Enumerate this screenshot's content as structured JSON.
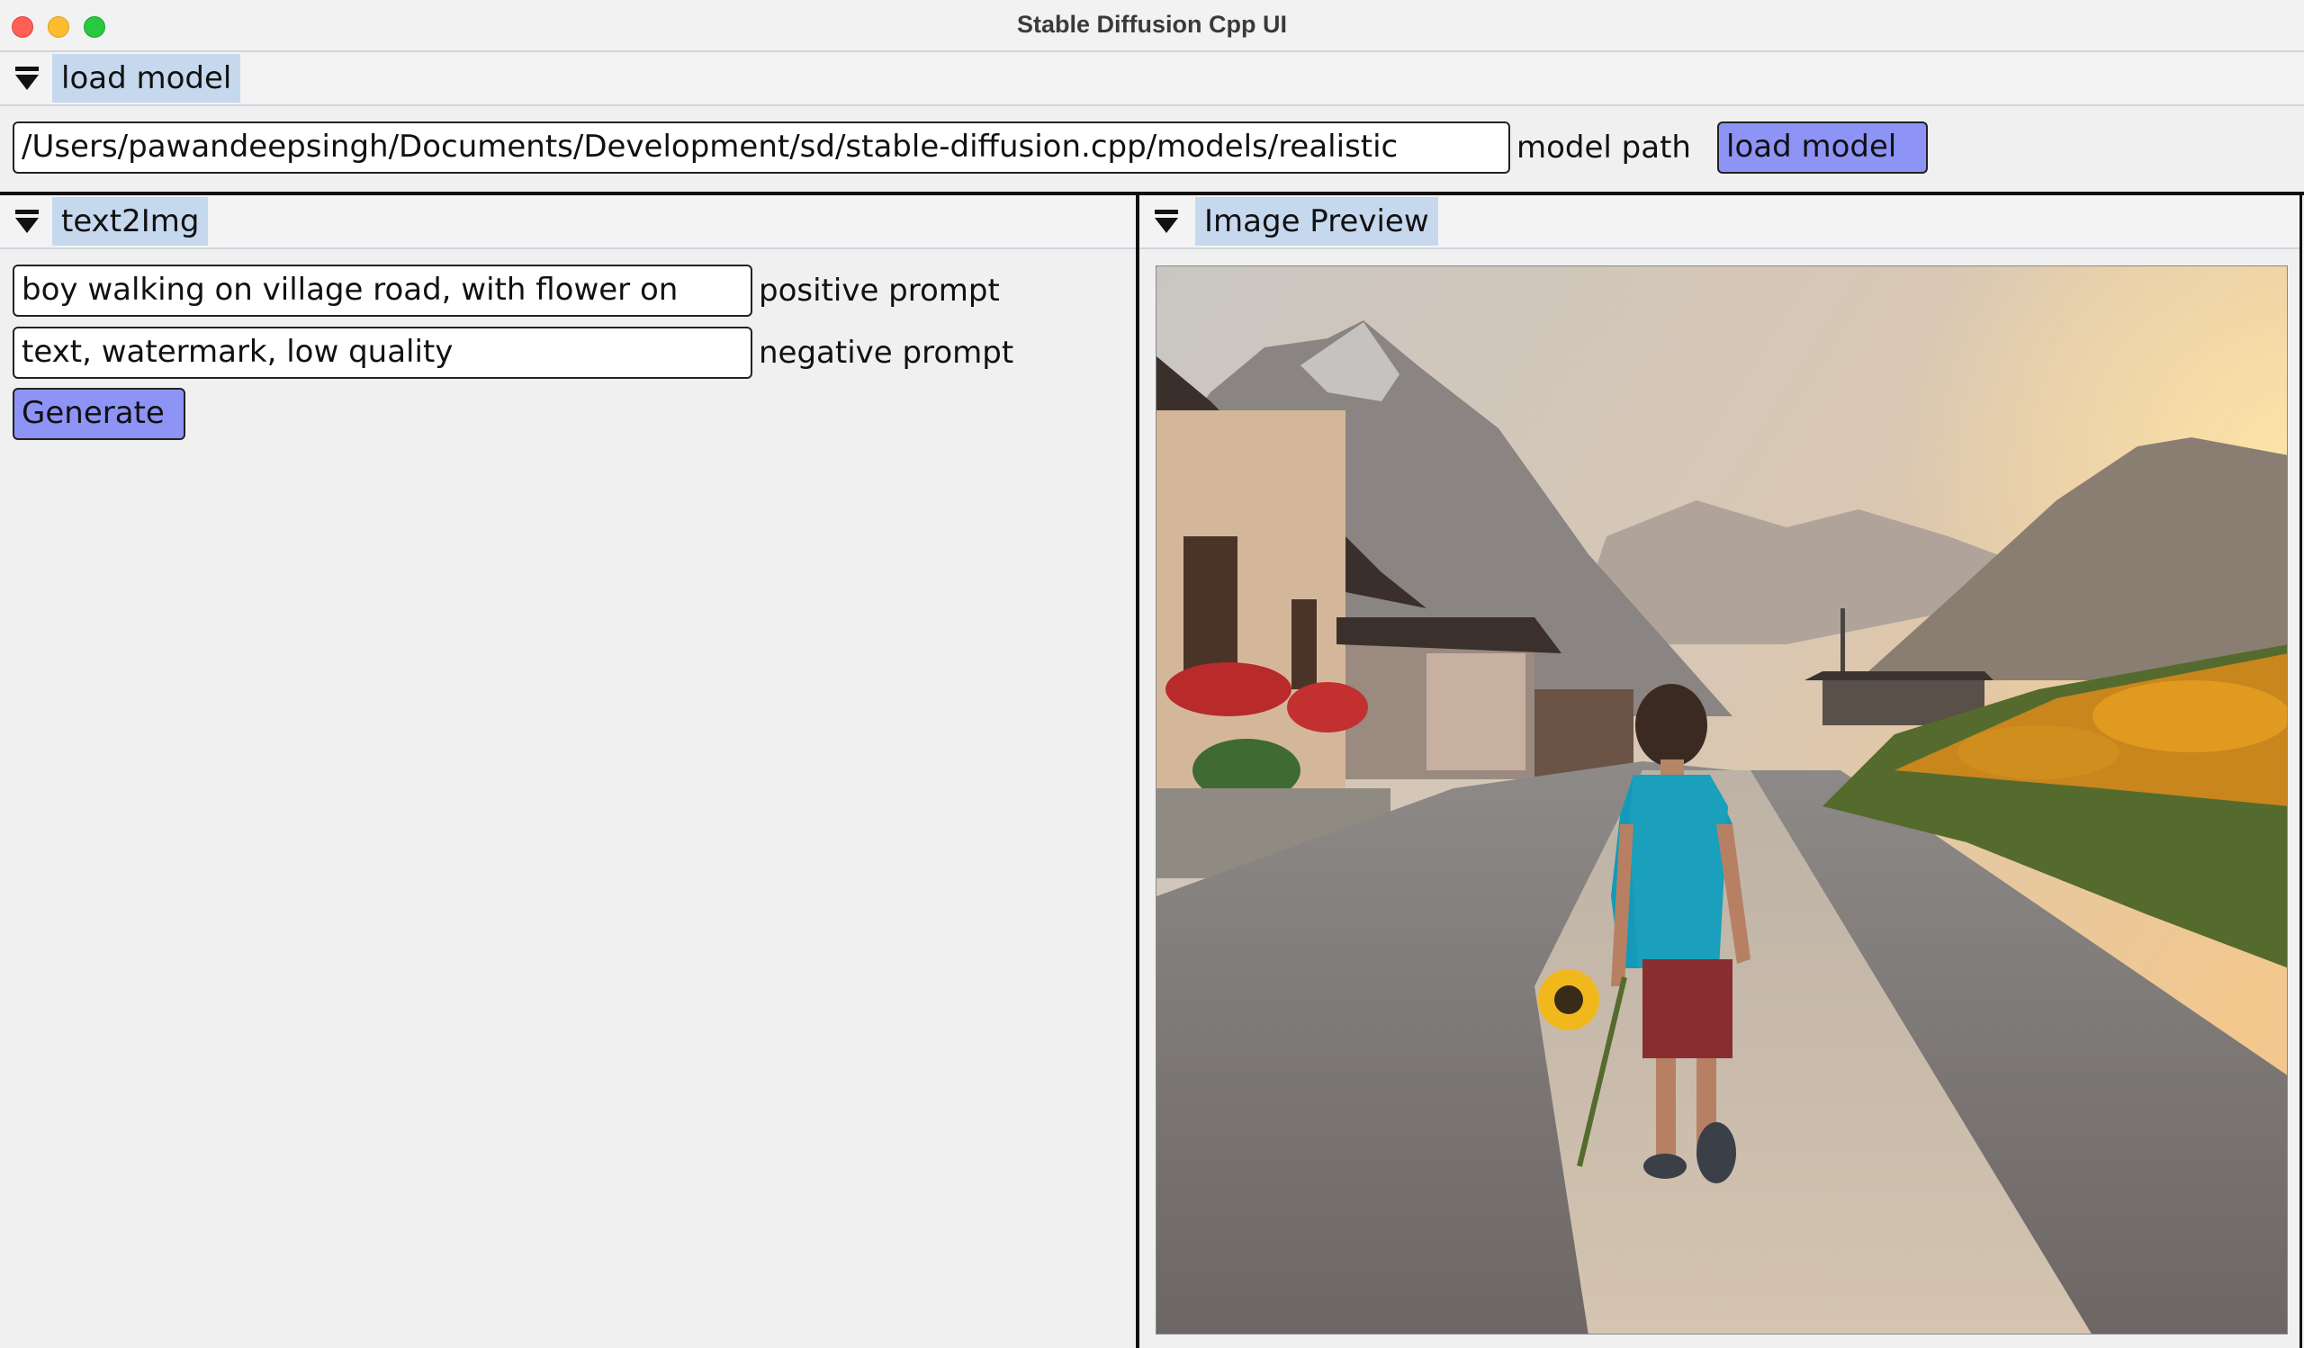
{
  "window": {
    "title": "Stable Diffusion Cpp UI"
  },
  "load_model_section": {
    "header": "load model",
    "model_path_value": "/Users/pawandeepsingh/Documents/Development/sd/stable-diffusion.cpp/models/realistic",
    "model_path_label": "model path",
    "load_button": "load model"
  },
  "text2img_section": {
    "header": "text2Img",
    "positive_prompt_value": "boy walking on village road, with flower on",
    "positive_prompt_label": "positive prompt",
    "negative_prompt_value": "text, watermark, low quality",
    "negative_prompt_label": "negative prompt",
    "generate_button": "Generate"
  },
  "preview_section": {
    "header": "Image Preview"
  },
  "colors": {
    "button_accent": "#8e93f6",
    "header_highlight": "#c6d8ee",
    "close": "#ff5f57",
    "minimize": "#febc2e",
    "maximize": "#28c840"
  }
}
